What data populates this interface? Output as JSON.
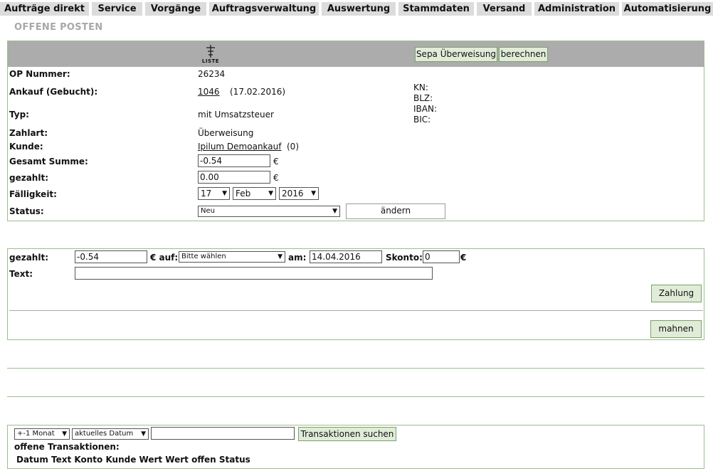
{
  "nav": {
    "tabs": [
      {
        "label": "Aufträge direkt"
      },
      {
        "label": "Service"
      },
      {
        "label": "Vorgänge"
      },
      {
        "label": "Auftragsverwaltung"
      },
      {
        "label": "Auswertung"
      },
      {
        "label": "Stammdaten"
      },
      {
        "label": "Versand"
      },
      {
        "label": "Administration"
      },
      {
        "label": "Automatisierung"
      }
    ]
  },
  "page": {
    "title": "OFFENE POSTEN"
  },
  "header_bar": {
    "list_icon_label": "LISTE",
    "sepa_button": "Sepa Überweisung",
    "calc_button": "berechnen"
  },
  "op": {
    "number_label": "OP Nummer:",
    "number_value": "26234",
    "purchase_label": "Ankauf (Gebucht):",
    "purchase_link": "1046",
    "purchase_date": "(17.02.2016)",
    "type_label": "Typ:",
    "type_value": "mit Umsatzsteuer",
    "paymode_label": "Zahlart:",
    "paymode_value": "Überweisung",
    "customer_label": "Kunde:",
    "customer_link": "Ipilum Demoankauf",
    "customer_count": "(0)",
    "total_label": "Gesamt Summe:",
    "total_value": "-0.54",
    "paid_label": "gezahlt:",
    "paid_value": "0.00",
    "currency": "€",
    "due_label": "Fälligkeit:",
    "due_day": "17",
    "due_month": "Feb",
    "due_year": "2016",
    "status_label": "Status:",
    "status_value": "Neu",
    "change_button": "ändern",
    "bank": {
      "kn": "KN:",
      "blz": "BLZ:",
      "iban": "IBAN:",
      "bic": "BIC:"
    }
  },
  "payment": {
    "paid_label": "gezahlt:",
    "paid_value": "-0.54",
    "on_label": "€ auf:",
    "account_select": "Bitte wählen",
    "date_label": "am:",
    "date_value": "14.04.2016",
    "skonto_label": "Skonto:",
    "skonto_value": "0",
    "currency": "€",
    "text_label": "Text:",
    "text_value": "",
    "pay_button": "Zahlung",
    "remind_button": "mahnen"
  },
  "transactions": {
    "range_select": "+-1 Monat",
    "date_select": "aktuelles Datum",
    "search_value": "",
    "search_button": "Transaktionen suchen",
    "heading": "offene Transaktionen:",
    "columns": "Datum Text Konto Kunde Wert Wert offen Status"
  }
}
